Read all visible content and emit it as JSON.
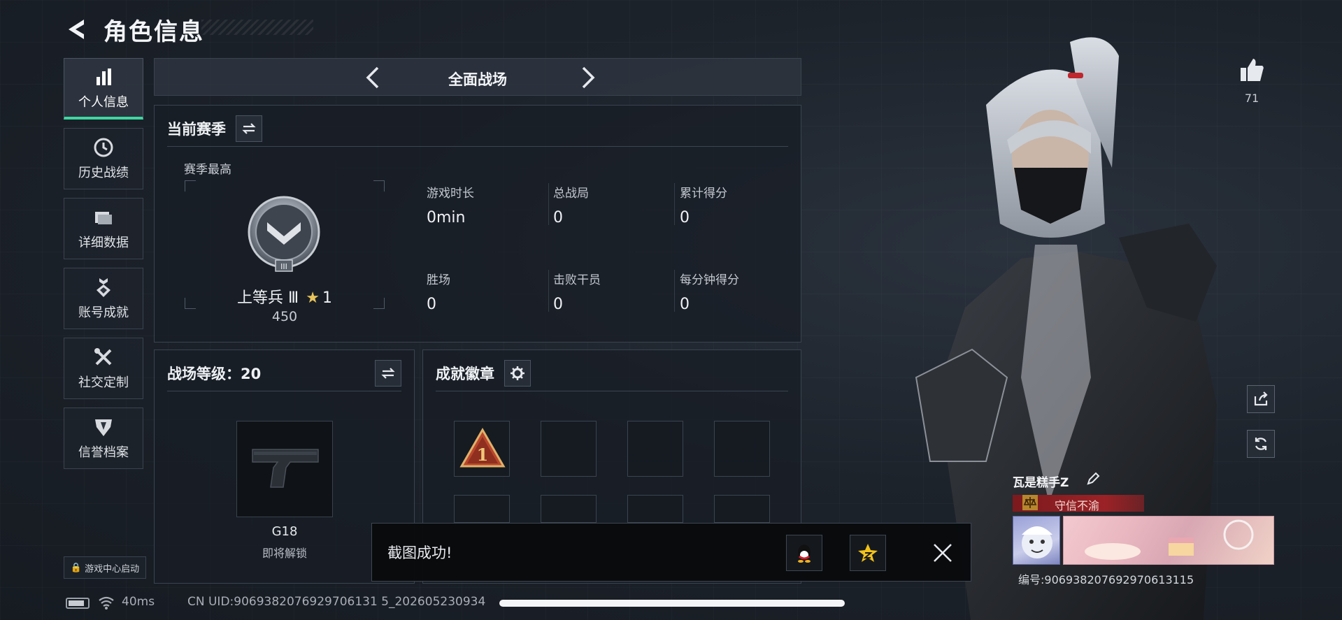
{
  "header": {
    "title": "角色信息"
  },
  "nav": {
    "items": [
      {
        "label": "个人信息",
        "icon": "bar-chart-icon",
        "active": true
      },
      {
        "label": "历史战绩",
        "icon": "clock-icon",
        "active": false
      },
      {
        "label": "详细数据",
        "icon": "folder-icon",
        "active": false
      },
      {
        "label": "账号成就",
        "icon": "medal-icon",
        "active": false
      },
      {
        "label": "社交定制",
        "icon": "tools-icon",
        "active": false
      },
      {
        "label": "信誉档案",
        "icon": "shield-icon",
        "active": false
      }
    ],
    "game_center": "游戏中心启动"
  },
  "mode": {
    "title": "全面战场"
  },
  "season": {
    "title": "当前赛季",
    "best_label": "赛季最高",
    "rank_name": "上等兵 Ⅲ",
    "rank_stars": "1",
    "rank_points": "450",
    "stats": [
      {
        "label": "游戏时长",
        "value": "0min"
      },
      {
        "label": "总战局",
        "value": "0"
      },
      {
        "label": "累计得分",
        "value": "0"
      },
      {
        "label": "胜场",
        "value": "0"
      },
      {
        "label": "击败干员",
        "value": "0"
      },
      {
        "label": "每分钟得分",
        "value": "0"
      }
    ]
  },
  "battlefield": {
    "title": "战场等级：20",
    "weapon_name": "G18",
    "weapon_status": "即将解锁"
  },
  "badges": {
    "title": "成就徽章",
    "first_badge": "1"
  },
  "side": {
    "likes": "71"
  },
  "player": {
    "name": "瓦是糕手Z",
    "honor": "守信不渝",
    "uid": "编号:906938207692970613115"
  },
  "toast": {
    "text": "截图成功!"
  },
  "status": {
    "ping": "40ms",
    "uid": "CN UID:9069382076929706131 5_202605230934"
  },
  "colors": {
    "accent": "#3fd6a0",
    "honor": "#9b2226",
    "star": "#e9c45c"
  }
}
